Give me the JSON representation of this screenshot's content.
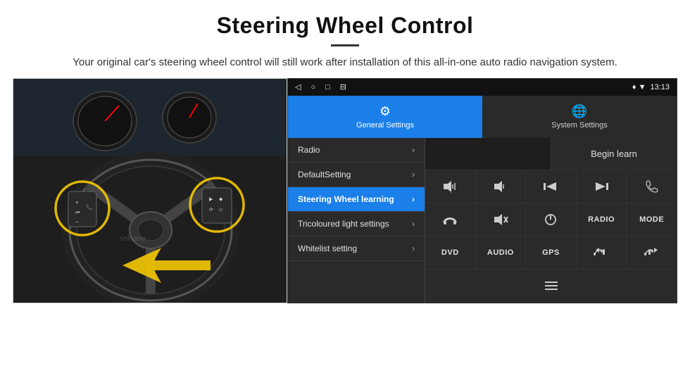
{
  "header": {
    "title": "Steering Wheel Control",
    "subtitle": "Your original car's steering wheel control will still work after installation of this all-in-one auto radio navigation system."
  },
  "status_bar": {
    "nav_back": "◁",
    "nav_home": "○",
    "nav_recent": "□",
    "nav_cast": "⊟",
    "gps_icon": "♦",
    "wifi_icon": "▼",
    "time": "13:13"
  },
  "tabs": [
    {
      "id": "general",
      "label": "General Settings",
      "active": true
    },
    {
      "id": "system",
      "label": "System Settings",
      "active": false
    }
  ],
  "menu_items": [
    {
      "id": "radio",
      "label": "Radio",
      "active": false
    },
    {
      "id": "default",
      "label": "DefaultSetting",
      "active": false
    },
    {
      "id": "steering",
      "label": "Steering Wheel learning",
      "active": true
    },
    {
      "id": "tricoloured",
      "label": "Tricoloured light settings",
      "active": false
    },
    {
      "id": "whitelist",
      "label": "Whitelist setting",
      "active": false
    }
  ],
  "control": {
    "begin_learn_label": "Begin learn",
    "rows": [
      [
        {
          "icon": "🔈+",
          "label": "vol_up"
        },
        {
          "icon": "🔈−",
          "label": "vol_down"
        },
        {
          "icon": "⏮",
          "label": "prev"
        },
        {
          "icon": "⏭",
          "label": "next"
        },
        {
          "icon": "📞",
          "label": "call"
        }
      ],
      [
        {
          "icon": "↩",
          "label": "back"
        },
        {
          "icon": "🔈✕",
          "label": "mute"
        },
        {
          "icon": "⏻",
          "label": "power"
        },
        {
          "text": "RADIO",
          "label": "radio_btn"
        },
        {
          "text": "MODE",
          "label": "mode_btn"
        }
      ],
      [
        {
          "text": "DVD",
          "label": "dvd_btn"
        },
        {
          "text": "AUDIO",
          "label": "audio_btn"
        },
        {
          "text": "GPS",
          "label": "gps_btn"
        },
        {
          "icon": "📞⏮",
          "label": "call_prev"
        },
        {
          "icon": "📞⏭",
          "label": "call_next"
        }
      ],
      [
        {
          "icon": "≡",
          "label": "menu_icon"
        }
      ]
    ]
  }
}
